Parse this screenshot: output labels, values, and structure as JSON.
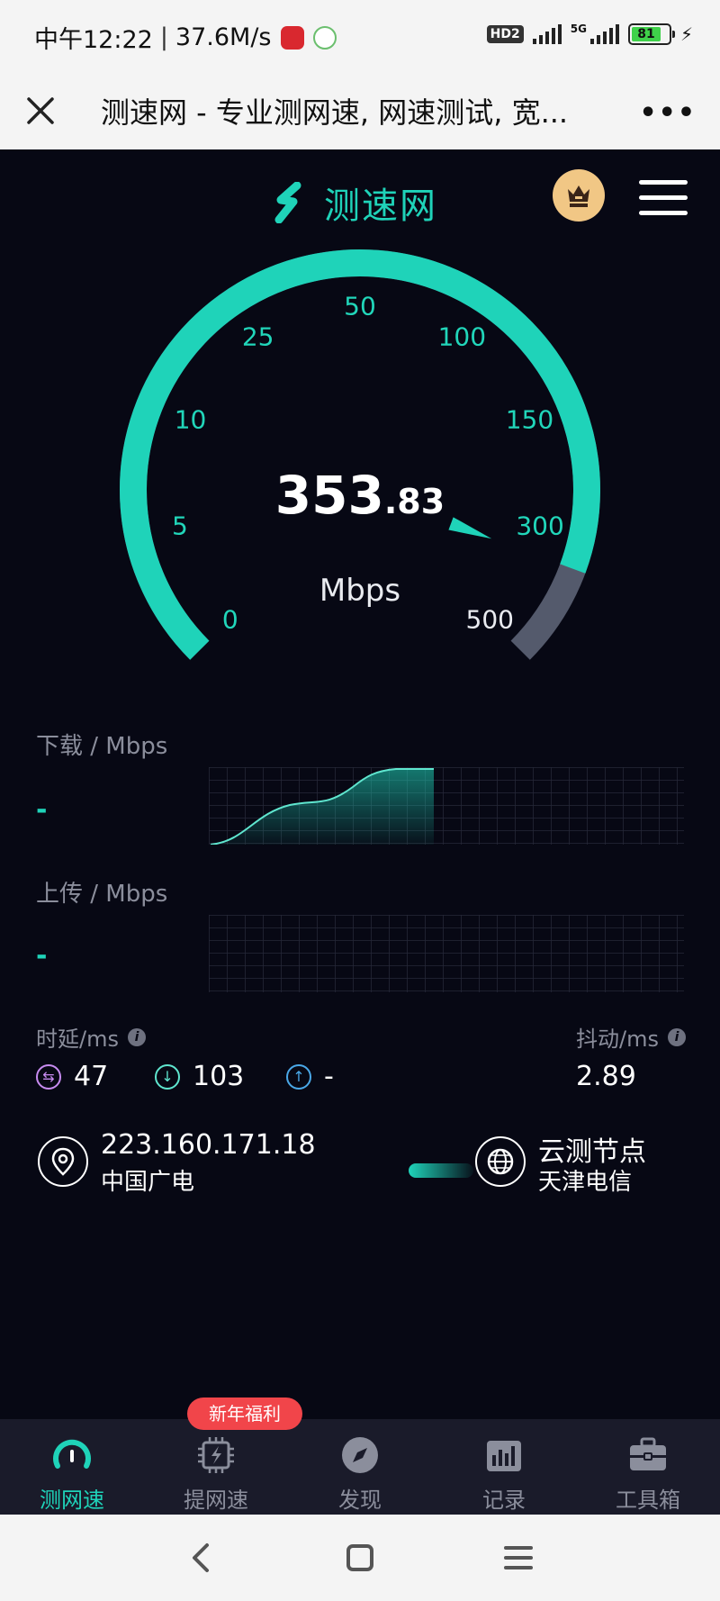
{
  "status_bar": {
    "time": "中午12:22",
    "separator": "|",
    "net_speed": "37.6M/s",
    "hd_label": "HD2",
    "network_type": "5G",
    "battery": "81"
  },
  "browser": {
    "title": "测速网 - 专业测网速, 网速测试, 宽...",
    "more_label": "•••"
  },
  "app": {
    "logo_text": "测速网"
  },
  "gauge": {
    "ticks": [
      "0",
      "5",
      "10",
      "25",
      "50",
      "100",
      "150",
      "300",
      "500"
    ],
    "speed_int": "353",
    "speed_dec": ".83",
    "unit": "Mbps",
    "accent_color": "#1fd3b9",
    "track_color": "#545a6c"
  },
  "download": {
    "label": "下载 / Mbps",
    "value": "-"
  },
  "upload": {
    "label": "上传 / Mbps",
    "value": "-"
  },
  "latency": {
    "label": "时延/ms",
    "ping": "47",
    "down": "103",
    "up": "-",
    "jitter_label": "抖动/ms",
    "jitter": "2.89"
  },
  "client": {
    "ip": "223.160.171.18",
    "isp": "中国广电"
  },
  "server": {
    "name": "云测节点",
    "location": "天津电信"
  },
  "nav": {
    "badge": "新年福利",
    "items": [
      {
        "label": "测网速",
        "icon": "speedometer-icon"
      },
      {
        "label": "提网速",
        "icon": "chip-bolt-icon"
      },
      {
        "label": "发现",
        "icon": "compass-icon"
      },
      {
        "label": "记录",
        "icon": "chart-icon"
      },
      {
        "label": "工具箱",
        "icon": "toolbox-icon"
      }
    ]
  }
}
